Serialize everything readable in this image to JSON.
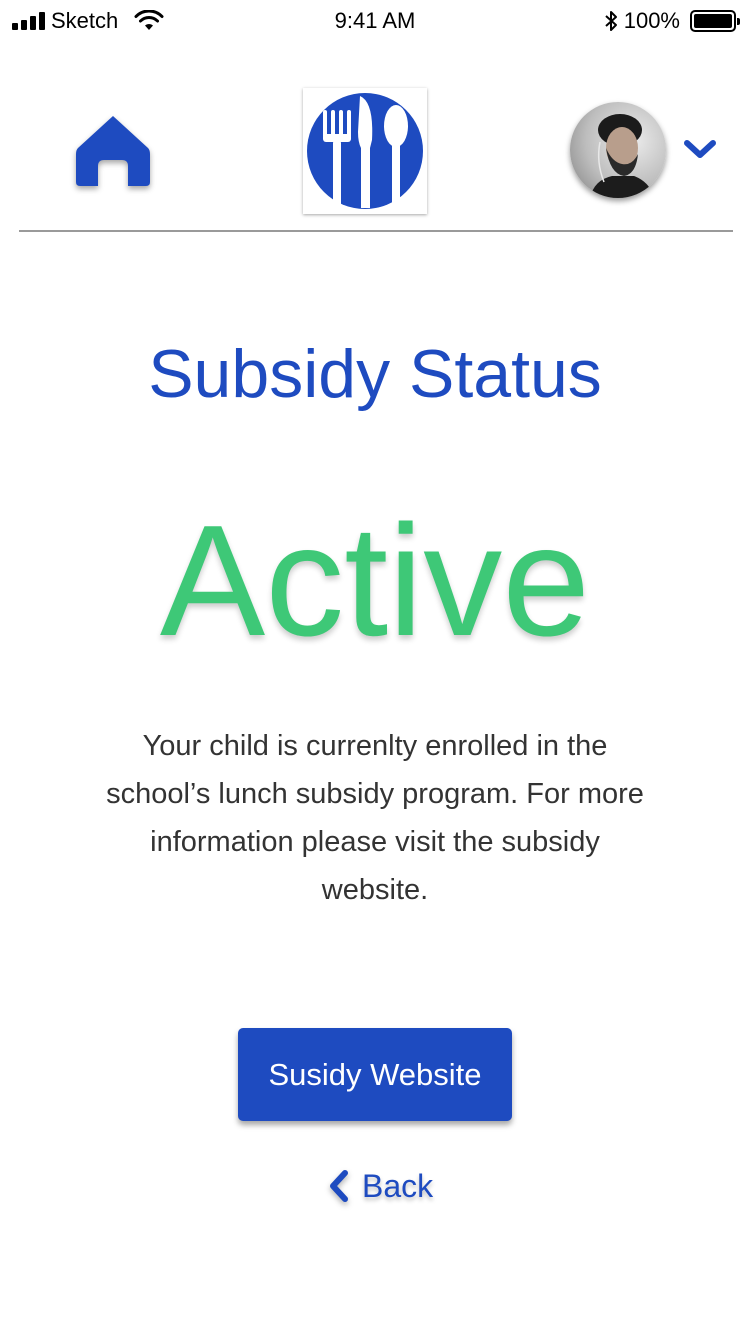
{
  "status_bar": {
    "carrier": "Sketch",
    "time": "9:41 AM",
    "battery": "100%",
    "battery_level": 1.0,
    "icons": [
      "signal-icon",
      "wifi-icon",
      "bluetooth-icon",
      "battery-icon"
    ]
  },
  "header": {
    "icons": {
      "home": "home-icon",
      "logo": "fork-knife-spoon-logo",
      "avatar": "user-avatar",
      "menu": "chevron-down-icon"
    }
  },
  "main": {
    "title": "Subsidy Status",
    "status": "Active",
    "description": "Your child is currenlty enrolled in the school’s lunch subsidy program. For more information please visit the subsidy website.",
    "website_button_label": "Susidy Website",
    "back_label": "Back"
  },
  "colors": {
    "primary": "#1e4bc0",
    "status_active": "#3ec877",
    "body_text": "#333333",
    "divider": "#9a9a9a"
  }
}
